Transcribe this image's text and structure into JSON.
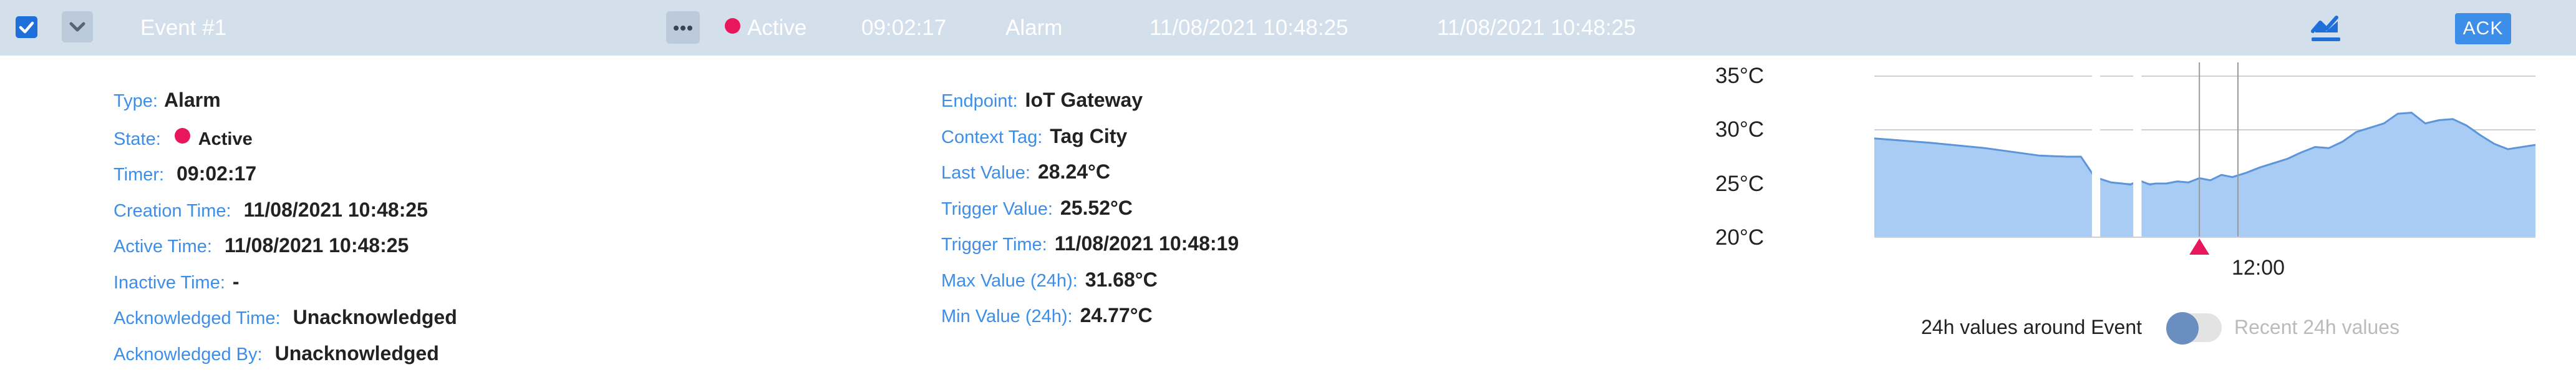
{
  "header": {
    "checkbox_checked": true,
    "event_name": "Event #1",
    "state": "Active",
    "timer": "09:02:17",
    "type": "Alarm",
    "creation_time": "11/08/2021 10:48:25",
    "active_time": "11/08/2021 10:48:25",
    "ack_label": "ACK",
    "icons": [
      "checkbox-check-icon",
      "chevron-down-icon",
      "more-icon",
      "trend-chart-icon"
    ],
    "colors": {
      "header_bg": "#d4dfec",
      "active_dot": "#e8175d",
      "accent": "#3d8ee8"
    }
  },
  "details_left": [
    {
      "label": "Type:",
      "value": "Alarm"
    },
    {
      "label": "State:",
      "value": "Active"
    },
    {
      "label": "Timer:",
      "value": "09:02:17"
    },
    {
      "label": "Creation Time:",
      "value": "11/08/2021 10:48:25"
    },
    {
      "label": "Active Time:",
      "value": "11/08/2021 10:48:25"
    },
    {
      "label": "Inactive Time:",
      "value": "-"
    },
    {
      "label": "Acknowledged Time:",
      "value": "Unacknowledged"
    },
    {
      "label": "Acknowledged By:",
      "value": "Unacknowledged"
    }
  ],
  "details_right": [
    {
      "label": "Endpoint:",
      "value": "IoT Gateway"
    },
    {
      "label": "Context Tag:",
      "value": "Tag City"
    },
    {
      "label": "Last Value:",
      "value": "28.24°C"
    },
    {
      "label": "Trigger Value:",
      "value": "25.52°C"
    },
    {
      "label": "Trigger Time:",
      "value": "11/08/2021 10:48:19"
    },
    {
      "label": "Max Value (24h):",
      "value": "31.68°C"
    },
    {
      "label": "Min Value (24h):",
      "value": "24.77°C"
    }
  ],
  "chart_data": {
    "type": "area",
    "title": "",
    "xlabel": "",
    "ylabel": "",
    "ylim": [
      20,
      35
    ],
    "y_ticks": [
      "35°C",
      "30°C",
      "25°C",
      "20°C"
    ],
    "x_ticks": [
      "12:00"
    ],
    "grid": true,
    "x_range_hours": [
      0,
      24
    ],
    "series": [
      {
        "x": [
          0,
          2,
          4,
          6,
          7,
          7.5,
          8,
          8.6,
          9,
          9.3,
          9.6,
          10,
          10.2,
          10.6,
          11,
          11.4,
          11.8,
          12.2,
          12.6,
          13,
          13.5,
          14,
          14.5,
          15,
          15.5,
          16,
          16.5,
          17,
          17.5,
          18,
          18.5,
          19,
          19.5,
          20,
          20.5,
          21,
          21.5,
          22,
          22.5,
          23,
          24
        ],
        "y": [
          29.2,
          28.8,
          28.3,
          27.6,
          27.5,
          27.5,
          25.6,
          25.1,
          25.0,
          24.9,
          25.3,
          24.9,
          25.0,
          25.0,
          25.2,
          25.1,
          25.5,
          25.3,
          25.8,
          25.6,
          26.0,
          26.5,
          26.9,
          27.3,
          27.9,
          28.4,
          28.3,
          28.9,
          29.8,
          30.2,
          30.6,
          31.5,
          31.6,
          30.6,
          30.9,
          31.0,
          30.4,
          29.5,
          28.7,
          28.2,
          28.6
        ]
      }
    ],
    "gaps": [
      [
        7.9,
        8.2
      ],
      [
        9.4,
        9.7
      ]
    ],
    "event_marker_x": 11.8,
    "now_marker_x": 13.2,
    "colors": {
      "fill": "#a9ccf4",
      "line": "#5c95da",
      "marker": "#e8175d"
    }
  },
  "chart_toggle": {
    "left_label": "24h values around Event",
    "right_label": "Recent 24h values",
    "state": "left"
  }
}
